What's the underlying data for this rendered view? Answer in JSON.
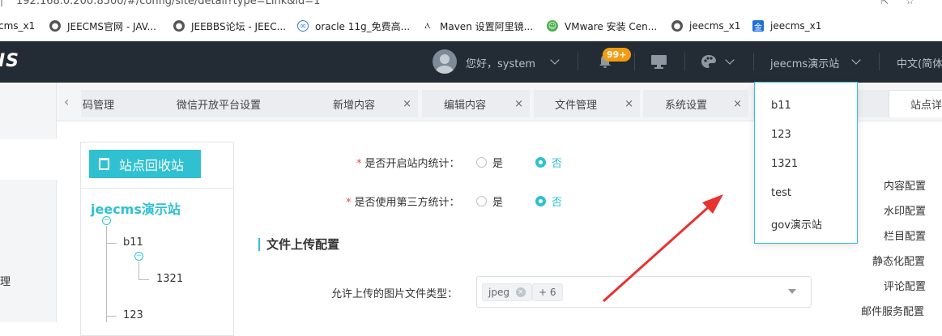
{
  "browser": {
    "url": "192.168.0.200:8500/#/config/site/detail?type=Link&id=1",
    "bookmarks": [
      {
        "label": "cms_x1",
        "icon": "page-icon"
      },
      {
        "label": "JEECMS官网 - JAV...",
        "icon": "globe-icon"
      },
      {
        "label": "JEEBBS论坛 - JEEC...",
        "icon": "globe-icon"
      },
      {
        "label": "oracle 11g_免费高...",
        "icon": "cloud-icon"
      },
      {
        "label": "Maven 设置阿里镜...",
        "icon": "maven-icon"
      },
      {
        "label": "VMware 安装 Cen...",
        "icon": "robot-icon"
      },
      {
        "label": "jeecms_x1",
        "icon": "globe-icon"
      },
      {
        "label": "jeecms_x1",
        "icon": "jin-icon"
      }
    ],
    "jin_glyph": "金"
  },
  "header": {
    "logo": "IS",
    "greeting": "您好，system",
    "badge": "99+",
    "site_selector": "jeecms演示站",
    "language": "中文(简体"
  },
  "leftnav": {
    "label": "理"
  },
  "tabs": [
    {
      "label": "码管理",
      "close": "×"
    },
    {
      "label": "微信开放平台设置",
      "close": "×"
    },
    {
      "label": "新增内容",
      "close": "×"
    },
    {
      "label": "编辑内容",
      "close": "×"
    },
    {
      "label": "文件管理",
      "close": "×"
    },
    {
      "label": "系统设置",
      "close": "×"
    },
    {
      "label": "",
      "close": "×"
    },
    {
      "label": "站点详",
      "close": ""
    }
  ],
  "tab_prev": "‹",
  "tree": {
    "recycle_label": "站点回收站",
    "root": "jeecms演示站",
    "nodes": [
      "b11",
      "1321",
      "123"
    ],
    "collapse_glyph": "−"
  },
  "form": {
    "stat_label": "是否开启站内统计：",
    "third_label": "是否使用第三方统计：",
    "required_mark": "*",
    "yes": "是",
    "no": "否",
    "stat_value": "否",
    "third_value": "否",
    "section_title": "文件上传配置",
    "image_types_label": "允许上传的图片文件类型：",
    "image_tag": "jpeg",
    "more_tags": "+ 6",
    "tag_close": "×"
  },
  "right_menu": [
    "内容配置",
    "水印配置",
    "栏目配置",
    "静态化配置",
    "评论配置",
    "邮件服务配置"
  ],
  "site_dropdown": [
    "b11",
    "123",
    "1321",
    "test",
    "gov演示站"
  ],
  "colors": {
    "accent": "#2fc1d1",
    "header_bg": "#232b34",
    "badge": "#f39c12",
    "annotation_arrow": "#e8322f"
  }
}
